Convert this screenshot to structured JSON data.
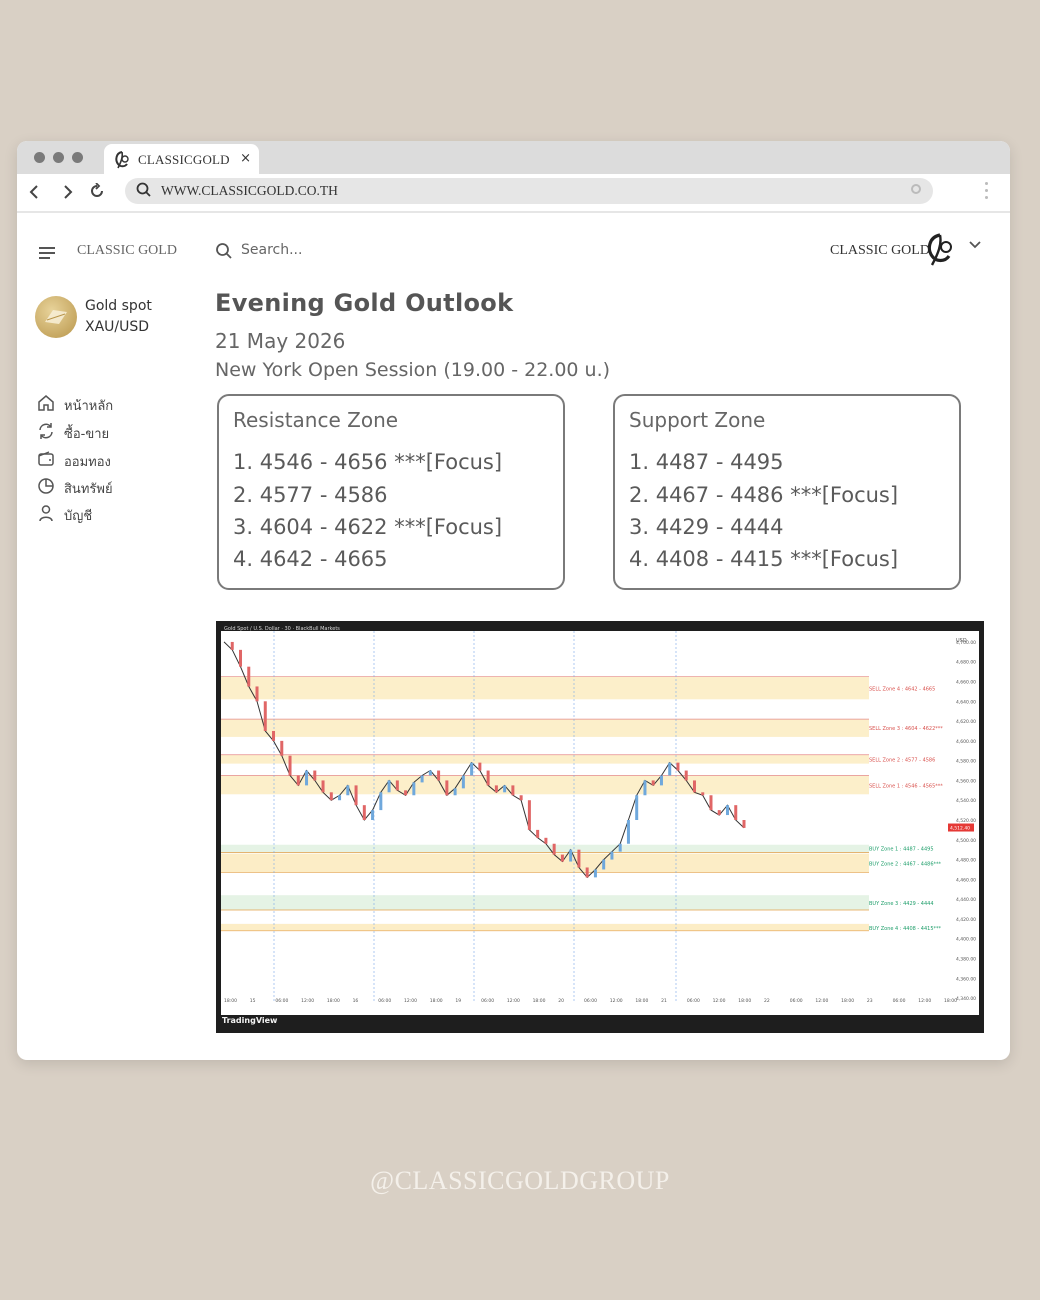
{
  "browser": {
    "tab_title": "CLASSICGOLD",
    "tab_close": "×",
    "url": "WWW.CLASSICGOLD.CO.TH"
  },
  "header": {
    "brand_left": "CLASSIC GOLD",
    "search_placeholder": "Search...",
    "brand_right": "CLASSIC GOLD"
  },
  "sidebar": {
    "asset_name": "Gold spot",
    "asset_symbol": "XAU/USD",
    "items": [
      {
        "label": "หน้าหลัก",
        "icon": "home-icon"
      },
      {
        "label": "ซื้อ-ขาย",
        "icon": "exchange-icon"
      },
      {
        "label": "ออมทอง",
        "icon": "wallet-icon"
      },
      {
        "label": "สินทรัพย์",
        "icon": "pie-chart-icon"
      },
      {
        "label": "บัญชี",
        "icon": "user-icon"
      }
    ]
  },
  "main": {
    "title": "Evening Gold Outlook",
    "date": "21 May 2026",
    "session": "New York Open Session (19.00 - 22.00 u.)",
    "resistance": {
      "title": "Resistance Zone",
      "items": [
        "1. 4546 - 4656 ***[Focus]",
        "2. 4577 - 4586",
        "3. 4604 - 4622 ***[Focus]",
        "4. 4642 - 4665"
      ]
    },
    "support": {
      "title": "Support Zone",
      "items": [
        "1. 4487 - 4495",
        "2. 4467 - 4486 ***[Focus]",
        "3. 4429 - 4444",
        "4. 4408 - 4415 ***[Focus]"
      ]
    }
  },
  "chart_data": {
    "type": "line",
    "header": "Gold Spot / U.S. Dollar · 30 · BlackBull Markets",
    "currency": "USD",
    "price_label": "4,512.40",
    "y_ticks": [
      4700,
      4680,
      4660,
      4640,
      4620,
      4600,
      4580,
      4560,
      4540,
      4520,
      4500,
      4480,
      4460,
      4440,
      4420,
      4400,
      4380,
      4360,
      4340
    ],
    "y_tick_labels": [
      "4,700.00",
      "4,680.00",
      "4,660.00",
      "4,640.00",
      "4,620.00",
      "4,600.00",
      "4,580.00",
      "4,560.00",
      "4,540.00",
      "4,520.00",
      "4,500.00",
      "4,480.00",
      "4,460.00",
      "4,440.00",
      "4,420.00",
      "4,400.00",
      "4,380.00",
      "4,360.00",
      "4,340.00"
    ],
    "ylim": [
      4335,
      4705
    ],
    "x_labels": [
      "18:00",
      "15",
      "06:00",
      "12:00",
      "18:00",
      "16",
      "06:00",
      "12:00",
      "18:00",
      "19",
      "06:00",
      "12:00",
      "18:00",
      "20",
      "06:00",
      "12:00",
      "18:00",
      "21",
      "06:00",
      "12:00",
      "18:00",
      "22",
      "06:00",
      "12:00",
      "18:00",
      "23",
      "06:00",
      "12:00",
      "18:00"
    ],
    "series": [
      {
        "values": [
          4700,
          4692,
          4675,
          4655,
          4640,
          4610,
          4600,
          4585,
          4565,
          4555,
          4570,
          4560,
          4548,
          4540,
          4545,
          4555,
          4535,
          4520,
          4530,
          4548,
          4560,
          4550,
          4545,
          4558,
          4565,
          4570,
          4560,
          4545,
          4552,
          4565,
          4578,
          4570,
          4555,
          4548,
          4555,
          4545,
          4540,
          4510,
          4502,
          4496,
          4485,
          4478,
          4490,
          4472,
          4462,
          4470,
          4480,
          4488,
          4496,
          4520,
          4545,
          4560,
          4555,
          4565,
          4578,
          4570,
          4560,
          4548,
          4545,
          4530,
          4525,
          4535,
          4520,
          4512
        ]
      }
    ],
    "zone_labels": [
      "SELL Zone 4 : 4642 - 4665",
      "SELL Zone 3 : 4604 - 4622***",
      "SELL Zone 2 : 4577 - 4586",
      "SELL Zone 1 : 4546 - 4565***",
      "BUY Zone 1 : 4487 - 4495",
      "BUY Zone 2 : 4467 - 4486***",
      "BUY Zone 3 : 4429 - 4444",
      "BUY Zone 4 : 4408 - 4415***"
    ],
    "sell_zones": [
      [
        4642,
        4665
      ],
      [
        4604,
        4622
      ],
      [
        4577,
        4586
      ],
      [
        4546,
        4565
      ]
    ],
    "buy_zones": [
      [
        4487,
        4495
      ],
      [
        4467,
        4486
      ],
      [
        4429,
        4444
      ],
      [
        4408,
        4415
      ]
    ],
    "footer": "TradingView"
  },
  "footer": {
    "handle": "@CLASSICGOLDGROUP"
  }
}
